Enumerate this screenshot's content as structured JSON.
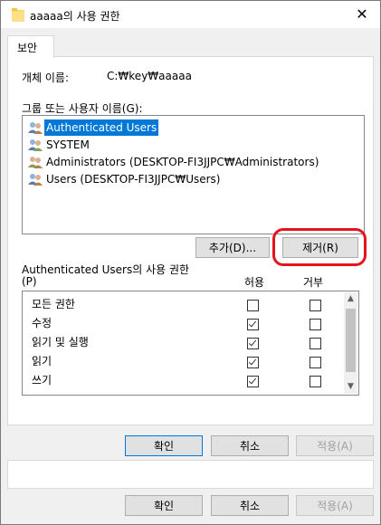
{
  "window": {
    "title": "aaaaa의 사용 권한",
    "close_glyph": "✕"
  },
  "tab": {
    "label": "보안"
  },
  "object": {
    "label": "개체 이름:",
    "value": "C:₩key₩aaaaa"
  },
  "groups": {
    "label": "그룹 또는 사용자 이름(G):",
    "items": [
      {
        "label": "Authenticated Users",
        "selected": true
      },
      {
        "label": "SYSTEM",
        "selected": false
      },
      {
        "label": "Administrators (DESKTOP-FI3JJPC₩Administrators)",
        "selected": false
      },
      {
        "label": "Users (DESKTOP-FI3JJPC₩Users)",
        "selected": false
      }
    ]
  },
  "buttons": {
    "add": "추가(D)...",
    "remove": "제거(R)",
    "ok": "확인",
    "cancel": "취소",
    "apply": "적용(A)"
  },
  "permissions": {
    "title": "Authenticated Users의 사용 권한",
    "title_line2": "(P)",
    "allow_header": "허용",
    "deny_header": "거부",
    "rows": [
      {
        "label": "모든 권한",
        "allow": false,
        "deny": false
      },
      {
        "label": "수정",
        "allow": true,
        "deny": false
      },
      {
        "label": "읽기 및 실행",
        "allow": true,
        "deny": false
      },
      {
        "label": "읽기",
        "allow": true,
        "deny": false
      },
      {
        "label": "쓰기",
        "allow": true,
        "deny": false
      }
    ]
  },
  "colors": {
    "selection": "#0078d7",
    "highlight_ring": "#e5141c"
  }
}
